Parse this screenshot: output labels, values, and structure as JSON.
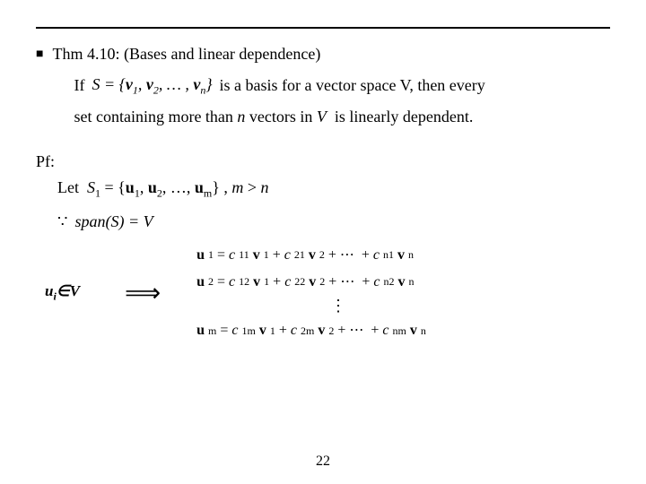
{
  "divider": true,
  "theorem": {
    "bullet": "■",
    "title": "Thm 4.10: (Bases and linear dependence)",
    "if_label": "If",
    "set_expr": "S = {v₁, v₂, … , vₙ}",
    "if_rest": "is a basis for a vector space V, then every",
    "set_line": "set containing more than n vectors in V  is linearly dependent."
  },
  "proof": {
    "label": "Pf:",
    "let_line": "Let  S₁ = {u₁, u₂, …, uₘ} , m > n",
    "span_prefix": "∵",
    "span_expr": "span(S) = V",
    "ui_label": "uᵢ∈V",
    "implies": "⟹",
    "equations": [
      "u₁ = c₁₁v₁ + c₂₁v₂ + ⋯  + cₙ₁vₙ",
      "u₂ = c₁₂v₁ + c₂₂v₂ + ⋯  + cₙ₂vₙ",
      "⋮",
      "uₘ = c₁ₘv₁ + c₂ₘv₂ + ⋯  + cₙₘvₙ"
    ]
  },
  "page_number": "22"
}
